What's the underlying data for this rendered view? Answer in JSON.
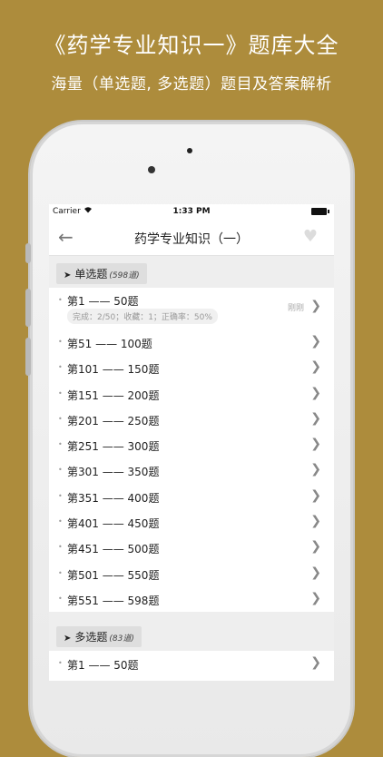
{
  "promo": {
    "title": "《药学专业知识一》题库大全",
    "subtitle": "海量（单选题, 多选题）题目及答案解析"
  },
  "status_bar": {
    "carrier": "Carrier",
    "wifi_icon": "wifi-icon",
    "time": "1:33 PM",
    "battery_icon": "battery-icon"
  },
  "nav": {
    "back_glyph": "←",
    "title": "药学专业知识（一）",
    "favorite_glyph": "♥"
  },
  "sections": [
    {
      "title": "单选题",
      "count": "(598道)",
      "items": [
        {
          "label": "第1 —— 50题",
          "stats": "完成：2/50；收藏：1；正确率：50%",
          "tag": "刚刚"
        },
        {
          "label": "第51 —— 100题"
        },
        {
          "label": "第101 —— 150题"
        },
        {
          "label": "第151 —— 200题"
        },
        {
          "label": "第201 —— 250题"
        },
        {
          "label": "第251 —— 300题"
        },
        {
          "label": "第301 —— 350题"
        },
        {
          "label": "第351 —— 400题"
        },
        {
          "label": "第401 —— 450题"
        },
        {
          "label": "第451 —— 500题"
        },
        {
          "label": "第501 —— 550题"
        },
        {
          "label": "第551 —— 598题"
        }
      ]
    },
    {
      "title": "多选题",
      "count": "(83道)",
      "items": [
        {
          "label": "第1 —— 50题"
        }
      ]
    }
  ],
  "colors": {
    "background": "#ad8c3c",
    "screen": "#ffffff",
    "section_bg": "#eeeeee"
  }
}
